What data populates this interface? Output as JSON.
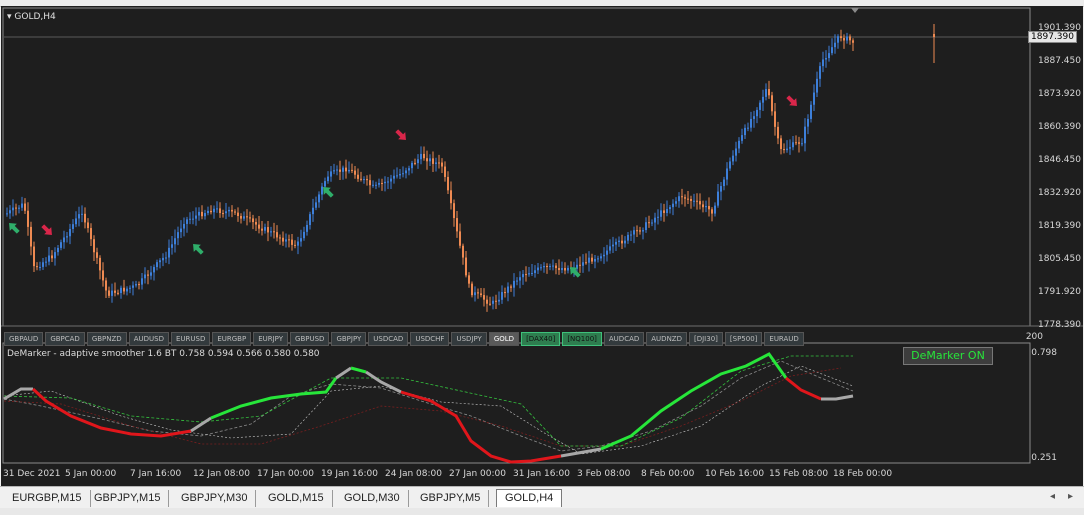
{
  "chart": {
    "title": "GOLD,H4",
    "current_price": "1897.390",
    "price_labels": [
      "1901.390",
      "1887.450",
      "1873.920",
      "1860.390",
      "1846.450",
      "1832.920",
      "1819.390",
      "1805.450",
      "1791.920",
      "1778.390"
    ],
    "indicator_title": "DeMarker - adaptive smoother 1.6  BT  0.758 0.594 0.566 0.580 0.580",
    "indicator_labels": [
      "0.798",
      "0.251",
      "200"
    ],
    "demarker_button": "DeMarker ON",
    "time_labels": [
      "31 Dec 2021",
      "5 Jan 00:00",
      "7 Jan 16:00",
      "12 Jan 08:00",
      "17 Jan 00:00",
      "19 Jan 16:00",
      "24 Jan 08:00",
      "27 Jan 00:00",
      "31 Jan 16:00",
      "3 Feb 08:00",
      "8 Feb 00:00",
      "10 Feb 16:00",
      "15 Feb 08:00",
      "18 Feb 00:00"
    ],
    "symbols": [
      {
        "label": "GBPAUD",
        "state": "normal"
      },
      {
        "label": "GBPCAD",
        "state": "normal"
      },
      {
        "label": "GBPNZD",
        "state": "normal"
      },
      {
        "label": "AUDUSD",
        "state": "normal"
      },
      {
        "label": "EURUSD",
        "state": "normal"
      },
      {
        "label": "EURGBP",
        "state": "normal"
      },
      {
        "label": "EURJPY",
        "state": "normal"
      },
      {
        "label": "GBPUSD",
        "state": "normal"
      },
      {
        "label": "GBPJPY",
        "state": "normal"
      },
      {
        "label": "USDCAD",
        "state": "normal"
      },
      {
        "label": "USDCHF",
        "state": "normal"
      },
      {
        "label": "USDJPY",
        "state": "normal"
      },
      {
        "label": "GOLD",
        "state": "active"
      },
      {
        "label": "[DAX40]",
        "state": "green"
      },
      {
        "label": "[NQ100]",
        "state": "green"
      },
      {
        "label": "AUDCAD",
        "state": "normal"
      },
      {
        "label": "AUDNZD",
        "state": "normal"
      },
      {
        "label": "[DJI30]",
        "state": "normal"
      },
      {
        "label": "[SP500]",
        "state": "normal"
      },
      {
        "label": "EURAUD",
        "state": "normal"
      }
    ],
    "colors": {
      "bull": "#3d7fd9",
      "bear": "#ee8a52",
      "arrow_up": "#2fae6a",
      "arrow_down": "#d9264a",
      "line_up": "#27e63a",
      "line_down": "#e0161b",
      "line_neutral": "#a8a8a8"
    }
  },
  "tabs": [
    {
      "label": "EURGBP,M15",
      "active": false
    },
    {
      "label": "GBPJPY,M15",
      "active": false
    },
    {
      "label": "GBPJPY,M30",
      "active": false
    },
    {
      "label": "GOLD,M15",
      "active": false
    },
    {
      "label": "GOLD,M30",
      "active": false
    },
    {
      "label": "GBPJPY,M5",
      "active": false
    },
    {
      "label": "GOLD,H4",
      "active": true
    }
  ],
  "nav": {
    "prev": "◂",
    "next": "▸"
  }
}
